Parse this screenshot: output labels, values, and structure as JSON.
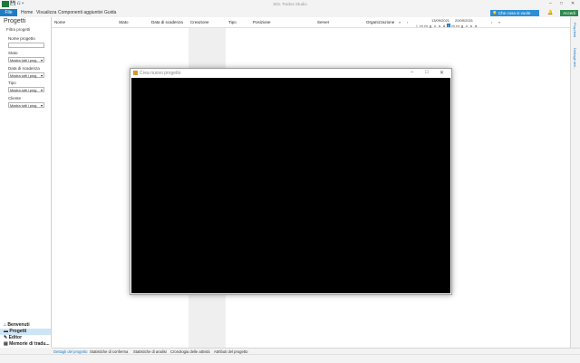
{
  "window": {
    "title": "SDL Trados Studio",
    "quick_access": "💾 ⎌ ▾",
    "controls": [
      "–",
      "□",
      "✕"
    ]
  },
  "ribbon": {
    "file_label": "File",
    "menu": [
      "Home",
      "Visualizza",
      "Componenti aggiuntivi",
      "Guida"
    ],
    "tell_me": "Che cosa si vuole fare?",
    "account": "Accedi"
  },
  "left_panel": {
    "title": "Progetti",
    "filter_title": "Filtra progetti",
    "fields": [
      {
        "label": "Nome progetto",
        "type": "input",
        "value": ""
      },
      {
        "label": "Stato",
        "type": "select",
        "value": "Mostra tutti i prog"
      },
      {
        "label": "Data di scadenza",
        "type": "select",
        "value": "Mostra tutti i prog"
      },
      {
        "label": "Tipo",
        "type": "select",
        "value": "Mostra tutti i prog"
      },
      {
        "label": "Cliente",
        "type": "select",
        "value": "Mostra tutti i prog"
      }
    ],
    "nav": [
      {
        "label": "Benvenuti",
        "icon": "home-icon",
        "selected": false
      },
      {
        "label": "Progetti",
        "icon": "folder-icon",
        "selected": true
      },
      {
        "label": "Editor",
        "icon": "pencil-icon",
        "selected": false
      },
      {
        "label": "Memorie di tradu...",
        "icon": "database-icon",
        "selected": false
      }
    ]
  },
  "grid": {
    "columns": [
      "Nome",
      "Stato",
      "Data di scadenza",
      "Creazione",
      "Tipo",
      "Posizione",
      "Server",
      "Organizzazione"
    ],
    "timeline": {
      "prev": "«",
      "next": "»",
      "date_start": "13/09/2021",
      "date_end": "20/09/2021",
      "days": [
        "l",
        "m",
        "m",
        "g",
        "v",
        "s",
        "d",
        "l",
        "m",
        "m",
        "g",
        "v",
        "s",
        "d"
      ],
      "today_index": 7
    }
  },
  "right_strip": {
    "items": [
      "Proprietà",
      "Dettagli dell..."
    ]
  },
  "bottom_tabs": [
    {
      "label": "Dettagli del progetto",
      "active": true
    },
    {
      "label": "Statistiche di conferma",
      "active": false
    },
    {
      "label": "Statistiche di analisi",
      "active": false
    },
    {
      "label": "Cronologia delle attività",
      "active": false
    },
    {
      "label": "Attributi del progetto",
      "active": false
    }
  ],
  "dialog": {
    "title": "Crea nuovo progetto",
    "controls": [
      "–",
      "□",
      "✕"
    ]
  },
  "colors": {
    "accent": "#1f7cc4",
    "account": "#2d8a4e",
    "selected_nav": "#cde6f7"
  }
}
